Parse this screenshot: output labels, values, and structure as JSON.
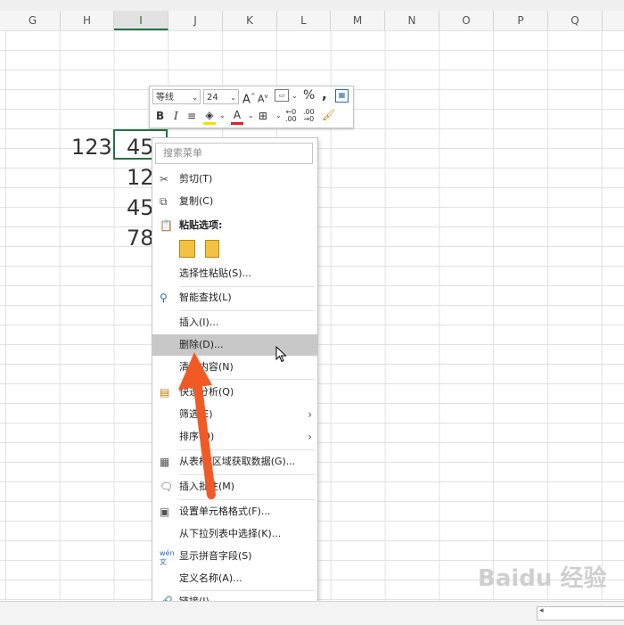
{
  "columns": [
    "G",
    "H",
    "I",
    "J",
    "K",
    "L",
    "M",
    "N",
    "O",
    "P",
    "Q"
  ],
  "cells": {
    "h_row1": "123",
    "i_row1": "45",
    "i_row2": "12",
    "i_row3": "45",
    "i_row4": "78"
  },
  "mini_toolbar": {
    "font_name": "等线",
    "font_size": "24",
    "bold": "B",
    "italic": "I",
    "percent": "%",
    "comma": ","
  },
  "context_menu": {
    "search_placeholder": "搜索菜单",
    "items": [
      {
        "label": "剪切(T)"
      },
      {
        "label": "复制(C)"
      },
      {
        "label": "粘贴选项:"
      },
      {
        "label": "选择性粘贴(S)..."
      },
      {
        "label": "智能查找(L)"
      },
      {
        "label": "插入(I)..."
      },
      {
        "label": "删除(D)..."
      },
      {
        "label": "清除内容(N)"
      },
      {
        "label": "快速分析(Q)"
      },
      {
        "label": "筛选(E)"
      },
      {
        "label": "排序(O)"
      },
      {
        "label": "从表格/区域获取数据(G)..."
      },
      {
        "label": "插入批注(M)"
      },
      {
        "label": "设置单元格格式(F)..."
      },
      {
        "label": "从下拉列表中选择(K)..."
      },
      {
        "label": "显示拼音字段(S)"
      },
      {
        "label": "定义名称(A)..."
      },
      {
        "label": "链接(I)"
      }
    ]
  },
  "annotation": {
    "arrow_color": "#f15a24"
  },
  "watermark": "Baidu 经验",
  "icons": [
    "scissors-icon",
    "copy-icon",
    "paste-icon",
    "search-icon",
    "quick-analysis-icon",
    "table-icon",
    "comment-icon",
    "format-cells-icon",
    "pinyin-icon",
    "link-icon",
    "cursor-icon"
  ]
}
